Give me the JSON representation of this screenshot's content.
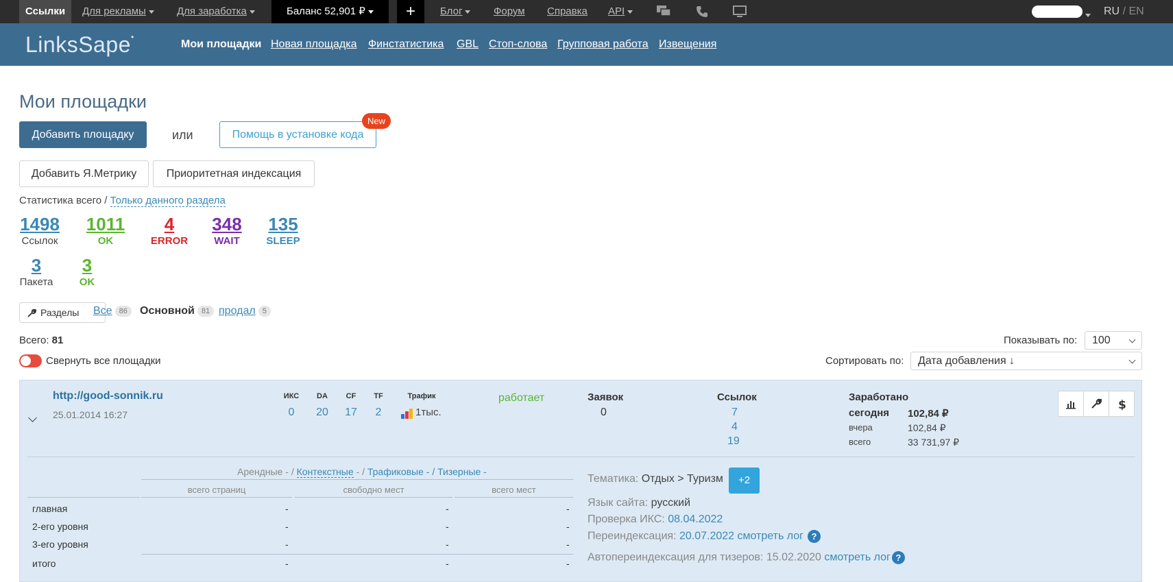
{
  "topbar": {
    "links_tab": "Ссылки",
    "for_ads": "Для рекламы",
    "for_earn": "Для заработка",
    "balance": "Баланс 52,901 ₽",
    "plus": "+",
    "blog": "Блог",
    "forum": "Форум",
    "help": "Справка",
    "api": "API",
    "lang_ru": "RU",
    "lang_sep": "/",
    "lang_en": "EN"
  },
  "header": {
    "logo": "LinksSape",
    "nav": [
      "Мои площадки",
      "Новая площадка",
      "Финстатистика",
      "GBL",
      "Стоп-слова",
      "Групповая работа",
      "Извещения"
    ]
  },
  "page": {
    "title": "Мои площадки",
    "add_site": "Добавить площадку",
    "or": "или",
    "help_install": "Помощь в установке кода",
    "new_badge": "New",
    "add_metrika": "Добавить Я.Метрику",
    "priority_index": "Приоритетная индексация",
    "stat_total": "Статистика всего /",
    "stat_section": "Только данного раздела"
  },
  "stats": {
    "row1": [
      {
        "num": "1498",
        "label": "Ссылок",
        "color": "#3a88b6",
        "label_color": "#444444"
      },
      {
        "num": "1011",
        "label": "OK",
        "color": "#5cb531",
        "label_color": "#5cb531"
      },
      {
        "num": "4",
        "label": "ERROR",
        "color": "#d9262d",
        "label_color": "#d9262d"
      },
      {
        "num": "348",
        "label": "WAIT",
        "color": "#7b2ea8",
        "label_color": "#7b2ea8"
      },
      {
        "num": "135",
        "label": "SLEEP",
        "color": "#3a88b6",
        "label_color": "#3a88b6"
      }
    ],
    "row2": [
      {
        "num": "3",
        "label": "Пакета",
        "color": "#3a88b6",
        "label_color": "#444444"
      },
      {
        "num": "3",
        "label": "OK",
        "color": "#5cb531",
        "label_color": "#5cb531"
      }
    ]
  },
  "filters": {
    "sections_btn": "Разделы",
    "tabs": [
      {
        "label": "Все",
        "count": "86"
      },
      {
        "label": "Основной",
        "count": "81"
      },
      {
        "label": "продал",
        "count": "5"
      }
    ]
  },
  "list": {
    "total_label": "Всего:",
    "total_value": "81",
    "collapse_all": "Свернуть все площадки",
    "show_by_label": "Показывать по:",
    "show_by_value": "100",
    "sort_by_label": "Сортировать по:",
    "sort_by_value": "Дата добавления ↓"
  },
  "site": {
    "url": "http://good-sonnik.ru",
    "date": "25.01.2014 16:27",
    "metrics": [
      {
        "h": "ИКС",
        "v": "0"
      },
      {
        "h": "DA",
        "v": "20"
      },
      {
        "h": "CF",
        "v": "17"
      },
      {
        "h": "TF",
        "v": "2"
      }
    ],
    "traffic_h": "Трафик",
    "traffic_v": "1тыс.",
    "status": "работает",
    "requests_h": "Заявок",
    "requests_v": "0",
    "links_h": "Ссылок",
    "links_v": [
      "7",
      "4",
      "19"
    ],
    "earned_h": "Заработано",
    "today_l": "сегодня",
    "today_v": "102,84 ₽",
    "yesterday_l": "вчера",
    "yesterday_v": "102,84 ₽",
    "total_l": "всего",
    "total_v": "33 731,97 ₽"
  },
  "details": {
    "types": [
      "Арендные - /",
      "Контекстные",
      " - /",
      "Трафиковые - /",
      "Тизерные -"
    ],
    "cols": [
      "всего страниц",
      "свободно мест",
      "всего мест"
    ],
    "rows": [
      {
        "label": "главная",
        "vals": [
          "-",
          "-",
          "-"
        ]
      },
      {
        "label": "2-его уровня",
        "vals": [
          "-",
          "-",
          "-"
        ]
      },
      {
        "label": "3-его уровня",
        "vals": [
          "-",
          "-",
          "-"
        ]
      },
      {
        "label": "итого",
        "vals": [
          "-",
          "-",
          "-"
        ]
      }
    ],
    "topic_l": "Тематика:",
    "topic_v": "Отдых > Туризм",
    "topic_more": "+2",
    "lang_l": "Язык сайта:",
    "lang_v": "русский",
    "iks_l": "Проверка ИКС:",
    "iks_v": "08.04.2022",
    "reindex_l": "Переиндексация:",
    "reindex_v": "20.07.2022",
    "reindex_log": "смотреть лог",
    "auto_l": "Автопереиндексация для тизеров:",
    "auto_v": "15.02.2020",
    "auto_log": "смотреть лог",
    "q": "?"
  }
}
